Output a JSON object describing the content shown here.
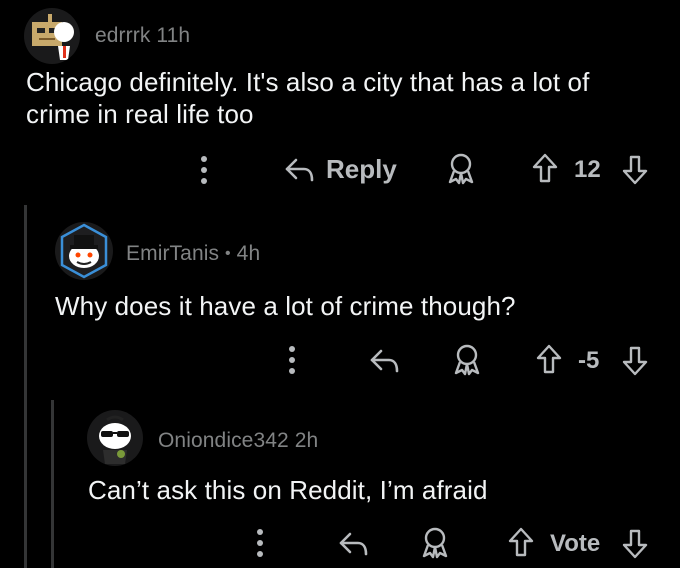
{
  "comments": [
    {
      "username": "edrrrk",
      "time": "11h",
      "body_line1": "Chicago definitely. It's also a city that has a lot of",
      "body_line2": "crime in real life too",
      "actions": {
        "reply_label": "Reply",
        "score": "12"
      },
      "avatar_icon": "snoo-box-head-avatar"
    },
    {
      "username": "EmirTanis",
      "separator": "•",
      "time": "4h",
      "body": "Why does it have a lot of crime though?",
      "actions": {
        "score": "-5"
      },
      "avatar_icon": "snoo-top-hat-avatar"
    },
    {
      "username": "Oniondice342",
      "time": "2h",
      "body": "Can’t ask this on Reddit, I’m afraid",
      "actions": {
        "score": "Vote"
      },
      "avatar_icon": "snoo-sunglasses-avatar"
    }
  ],
  "colors": {
    "background": "#000000",
    "text": "#f2f4f5",
    "meta": "#818384",
    "icon": "#b8bbbe",
    "thread_line": "#343536"
  }
}
